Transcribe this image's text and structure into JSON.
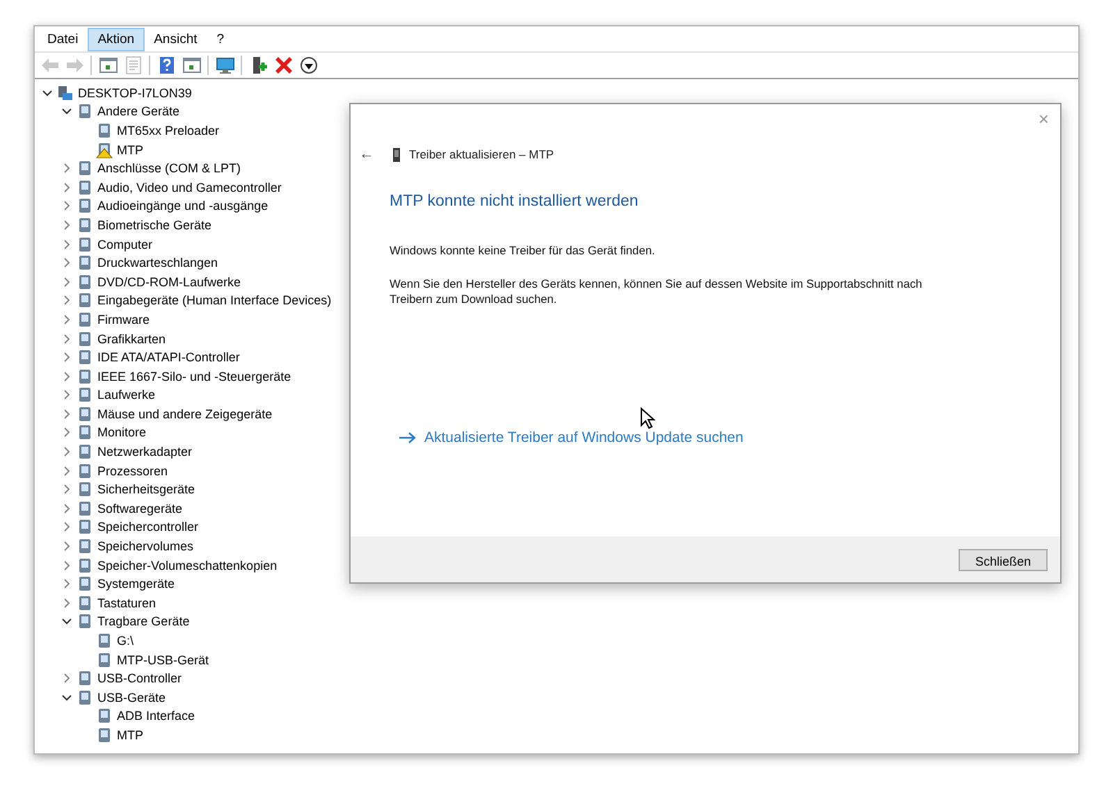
{
  "menu": [
    {
      "label": "Datei",
      "selected": false
    },
    {
      "label": "Aktion",
      "selected": true
    },
    {
      "label": "Ansicht",
      "selected": false
    },
    {
      "label": "?",
      "selected": false
    }
  ],
  "toolbar": [
    {
      "kind": "back",
      "disabled": true
    },
    {
      "kind": "forward",
      "disabled": true
    },
    {
      "kind": "sep"
    },
    {
      "kind": "view",
      "disabled": false
    },
    {
      "kind": "properties",
      "disabled": true
    },
    {
      "kind": "sep"
    },
    {
      "kind": "help",
      "disabled": false
    },
    {
      "kind": "view",
      "disabled": false
    },
    {
      "kind": "sep"
    },
    {
      "kind": "monitor",
      "disabled": false
    },
    {
      "kind": "sep"
    },
    {
      "kind": "add",
      "disabled": false
    },
    {
      "kind": "remove",
      "disabled": false
    },
    {
      "kind": "download",
      "disabled": false
    }
  ],
  "tree": [
    {
      "label": "DESKTOP-I7LON39",
      "expanded": true,
      "children": [
        {
          "label": "Andere Geräte",
          "expanded": true,
          "children": [
            {
              "label": "MT65xx Preloader",
              "warning": false
            },
            {
              "label": "MTP",
              "warning": true
            }
          ]
        },
        {
          "label": "Anschlüsse (COM & LPT)",
          "expanded": false
        },
        {
          "label": "Audio, Video und Gamecontroller",
          "expanded": false
        },
        {
          "label": "Audioeingänge und -ausgänge",
          "expanded": false
        },
        {
          "label": "Biometrische Geräte",
          "expanded": false
        },
        {
          "label": "Computer",
          "expanded": false
        },
        {
          "label": "Druckwarteschlangen",
          "expanded": false
        },
        {
          "label": "DVD/CD-ROM-Laufwerke",
          "expanded": false
        },
        {
          "label": "Eingabegeräte (Human Interface Devices)",
          "expanded": false
        },
        {
          "label": "Firmware",
          "expanded": false
        },
        {
          "label": "Grafikkarten",
          "expanded": false
        },
        {
          "label": "IDE ATA/ATAPI-Controller",
          "expanded": false
        },
        {
          "label": "IEEE 1667-Silo- und -Steuergeräte",
          "expanded": false
        },
        {
          "label": "Laufwerke",
          "expanded": false
        },
        {
          "label": "Mäuse und andere Zeigegeräte",
          "expanded": false
        },
        {
          "label": "Monitore",
          "expanded": false
        },
        {
          "label": "Netzwerkadapter",
          "expanded": false
        },
        {
          "label": "Prozessoren",
          "expanded": false
        },
        {
          "label": "Sicherheitsgeräte",
          "expanded": false
        },
        {
          "label": "Softwaregeräte",
          "expanded": false
        },
        {
          "label": "Speichercontroller",
          "expanded": false
        },
        {
          "label": "Speichervolumes",
          "expanded": false
        },
        {
          "label": "Speicher-Volumeschattenkopien",
          "expanded": false
        },
        {
          "label": "Systemgeräte",
          "expanded": false
        },
        {
          "label": "Tastaturen",
          "expanded": false
        },
        {
          "label": "Tragbare Geräte",
          "expanded": true,
          "children": [
            {
              "label": "G:\\",
              "warning": false
            },
            {
              "label": "MTP-USB-Gerät",
              "warning": false
            }
          ]
        },
        {
          "label": "USB-Controller",
          "expanded": false
        },
        {
          "label": "USB-Geräte",
          "expanded": true,
          "children": [
            {
              "label": "ADB Interface",
              "warning": false
            },
            {
              "label": "MTP",
              "warning": false
            }
          ]
        }
      ]
    }
  ],
  "dialog": {
    "close": "×",
    "back": "←",
    "title": "Treiber aktualisieren – MTP",
    "heading": "MTP konnte nicht installiert werden",
    "paragraphs": [
      "Windows konnte keine Treiber für das Gerät finden.",
      "Wenn Sie den Hersteller des Geräts kennen, können Sie auf dessen Website im Supportabschnitt nach Treibern zum Download suchen."
    ],
    "link": "Aktualisierte Treiber auf Windows Update suchen",
    "button": "Schließen"
  }
}
